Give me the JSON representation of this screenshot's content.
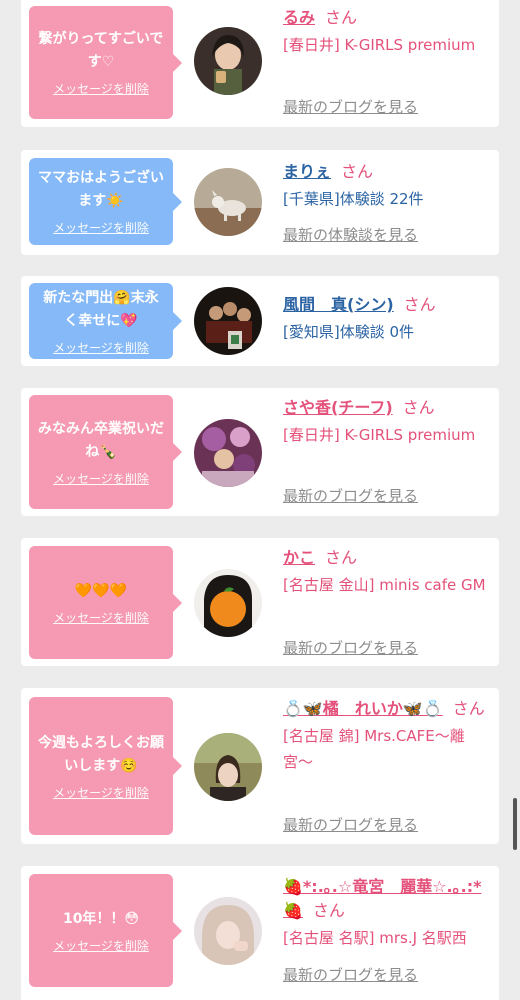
{
  "cards": [
    {
      "bubble": {
        "color": "pink",
        "message": "繋がりってすごいです♡",
        "delete_label": "メッセージを削除"
      },
      "avatar_icon": "woman-photo",
      "name": "るみ",
      "honorific": "さん",
      "detail": "[春日井] K-GIRLS premium",
      "link": "最新のブログを見る"
    },
    {
      "bubble": {
        "color": "blue",
        "message": "ママおはようございます☀️",
        "delete_label": "メッセージを削除"
      },
      "avatar_icon": "dog-photo",
      "name": "まりぇ",
      "honorific": "さん",
      "detail": "[千葉県]体験談 22件",
      "link": "最新の体験談を見る"
    },
    {
      "bubble": {
        "color": "blue",
        "message": "新たな門出🤗末永く幸せに💖",
        "delete_label": "メッセージを削除"
      },
      "avatar_icon": "group-photo",
      "name": "風間　真(シン)",
      "honorific": "さん",
      "detail": "[愛知県]体験談 0件",
      "link": ""
    },
    {
      "bubble": {
        "color": "pink",
        "message": "みなみん卒業祝いだね🍾",
        "delete_label": "メッセージを削除"
      },
      "avatar_icon": "party-photo",
      "name": "さや香(チーフ)",
      "honorific": "さん",
      "detail": "[春日井] K-GIRLS premium",
      "link": "最新のブログを見る"
    },
    {
      "bubble": {
        "color": "pink",
        "message": "🧡🧡🧡",
        "delete_label": "メッセージを削除"
      },
      "avatar_icon": "orange-face-photo",
      "name": "かこ",
      "honorific": "さん",
      "detail": "[名古屋 金山] minis cafe GM",
      "link": "最新のブログを見る"
    },
    {
      "bubble": {
        "color": "pink",
        "message": "今週もよろしくお願いします☺️",
        "delete_label": "メッセージを削除"
      },
      "avatar_icon": "selfie-photo",
      "name": "💍🦋橘　れいか🦋💍",
      "honorific": "さん",
      "detail": "[名古屋 錦] Mrs.CAFE〜離宮〜",
      "link": "最新のブログを見る"
    },
    {
      "bubble": {
        "color": "pink",
        "message": "10年！！😳",
        "delete_label": "メッセージを削除"
      },
      "avatar_icon": "blonde-selfie-photo",
      "name": "🍓*:.｡.☆竜宮　麗華☆.｡.:*🍓",
      "honorific": "さん",
      "detail": "[名古屋 名駅] mrs.J 名駅西",
      "link": "最新のブログを見る"
    }
  ],
  "colors": {
    "pink_bubble": "#f59ab2",
    "blue_bubble": "#86b9f7",
    "pink_text": "#e4517a",
    "blue_text": "#2b63a3",
    "link_gray": "#8c8c8c"
  }
}
